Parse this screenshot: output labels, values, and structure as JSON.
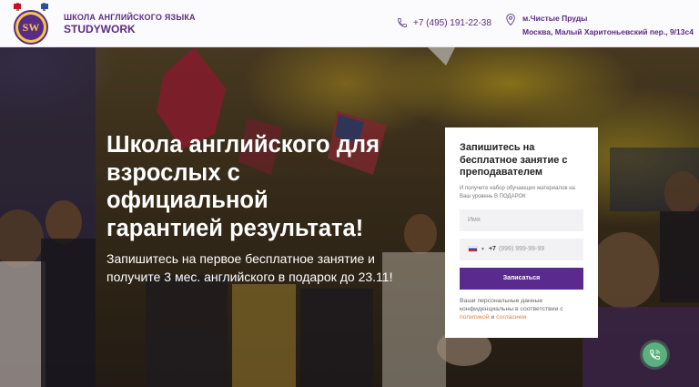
{
  "header": {
    "brand_line1": "ШКОЛА АНГЛИЙСКОГО ЯЗЫКА",
    "brand_line2": "STUDYWORK",
    "logo_letters": "SW",
    "phone": "+7 (495) 191-22-38",
    "address_metro": "м.Чистые Пруды",
    "address_street": "Москва, Малый Харитоньевский пер., 9/13с4"
  },
  "hero": {
    "title": "Школа английского для взрослых с официальной гарантией результата!",
    "subtitle": "Запишитесь на первое бесплатное занятие и получите 3 мес. английского в подарок до 23.11!"
  },
  "form": {
    "title": "Запишитесь на бесплатное занятие с преподавателем",
    "description": "И получите набор обучающих материалов на Ваш уровень В ПОДАРОК",
    "name_placeholder": "Имя",
    "phone_code": "+7",
    "phone_placeholder": "(999) 999-99-99",
    "submit_label": "Записаться",
    "privacy_text": "Ваши персональные данные конфиденциальны в соответствии с",
    "privacy_link1": "политикой",
    "privacy_and": "и",
    "privacy_link2": "согласием"
  },
  "colors": {
    "brand": "#5b2c86",
    "button": "#5a2a8e",
    "link": "#e0823a",
    "call_button": "#5bb07e"
  },
  "icons": {
    "phone": "phone-icon",
    "location": "location-pin-icon",
    "call": "phone-call-icon"
  }
}
